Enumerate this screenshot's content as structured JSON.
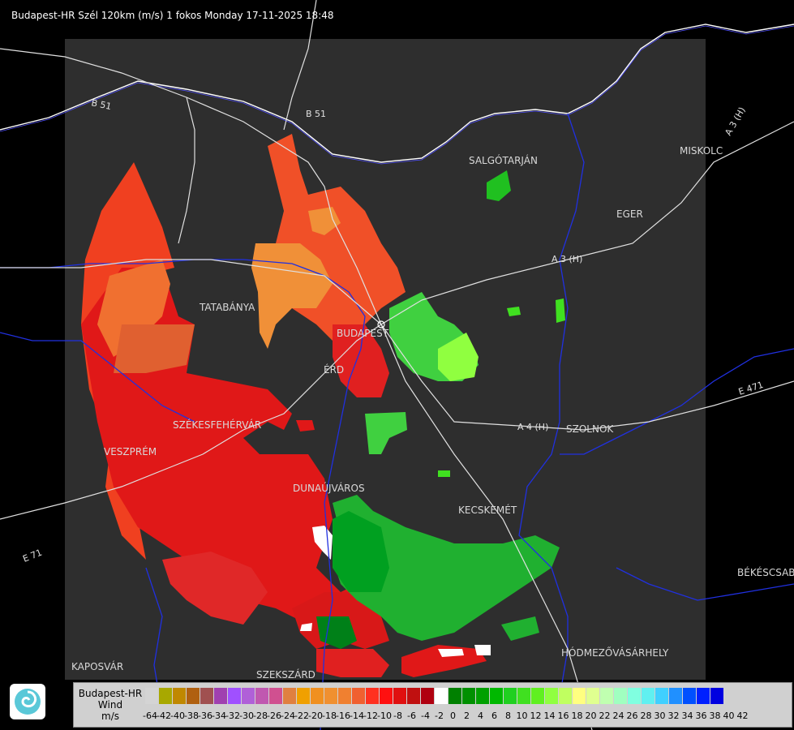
{
  "header": {
    "title": "Budapest-HR Szél 120km (m/s) 1 fokos Monday 17-11-2025 18:48"
  },
  "places": [
    {
      "id": "salgotarjan",
      "name": "SALGÓTARJÁN"
    },
    {
      "id": "miskolc",
      "name": "MISKOLC"
    },
    {
      "id": "eger",
      "name": "EGER"
    },
    {
      "id": "tatabanya",
      "name": "TATABÁNYA"
    },
    {
      "id": "budapest",
      "name": "BUDAPEST"
    },
    {
      "id": "erd",
      "name": "ÉRD"
    },
    {
      "id": "szolnok",
      "name": "SZOLNOK"
    },
    {
      "id": "szekesfehervar",
      "name": "SZÉKESFEHÉRVÁR"
    },
    {
      "id": "veszprem",
      "name": "VESZPRÉM"
    },
    {
      "id": "dunaujvaros",
      "name": "DUNAÚJVÁROS"
    },
    {
      "id": "kecskemet",
      "name": "KECSKEMÉT"
    },
    {
      "id": "bekescsaba",
      "name": "BÉKÉSCSABA"
    },
    {
      "id": "hodmezovasarhely",
      "name": "HÓDMEZŐVÁSÁRHELY"
    },
    {
      "id": "kaposvar",
      "name": "KAPOSVÁR"
    },
    {
      "id": "szekszard",
      "name": "SZEKSZÁRD"
    }
  ],
  "roads": [
    {
      "id": "b51a",
      "name": "B 51"
    },
    {
      "id": "b51b",
      "name": "B 51"
    },
    {
      "id": "a3a",
      "name": "A 3 (H)"
    },
    {
      "id": "a3b",
      "name": "A 3 (H)"
    },
    {
      "id": "a4",
      "name": "A 4 (H)"
    },
    {
      "id": "e471",
      "name": "E 471"
    },
    {
      "id": "e71",
      "name": "E 71"
    }
  ],
  "legend": {
    "name_line1": "Budapest-HR",
    "name_line2": "Wind",
    "unit": "m/s",
    "colors": [
      "#d4d4d4",
      "#a8a800",
      "#c08800",
      "#b06010",
      "#a05050",
      "#a040b0",
      "#a050ff",
      "#b060d8",
      "#c058b0",
      "#d05090",
      "#e08040",
      "#f0a000",
      "#f09020",
      "#f09030",
      "#f08030",
      "#f06030",
      "#ff3020",
      "#ff1010",
      "#e01010",
      "#c01010",
      "#b00010",
      "#ffffff",
      "#008000",
      "#009000",
      "#00a000",
      "#00b800",
      "#20d020",
      "#40e020",
      "#60f020",
      "#90ff40",
      "#c0ff60",
      "#ffff80",
      "#e0ff90",
      "#c0ffb0",
      "#a0ffc0",
      "#80ffe0",
      "#60f0f0",
      "#40d0ff",
      "#2090ff",
      "#0050ff",
      "#0020ff",
      "#0000e0"
    ],
    "ticks": [
      "-64",
      "-42",
      "-40",
      "-38",
      "-36",
      "-34",
      "-32",
      "-30",
      "-28",
      "-26",
      "-24",
      "-22",
      "-20",
      "-18",
      "-16",
      "-14",
      "-12",
      "-10",
      "-8",
      "-6",
      "-4",
      "-2",
      "0",
      "2",
      "4",
      "6",
      "8",
      "10",
      "12",
      "14",
      "16",
      "18",
      "20",
      "22",
      "24",
      "26",
      "28",
      "30",
      "32",
      "34",
      "36",
      "38",
      "40",
      "42"
    ]
  }
}
